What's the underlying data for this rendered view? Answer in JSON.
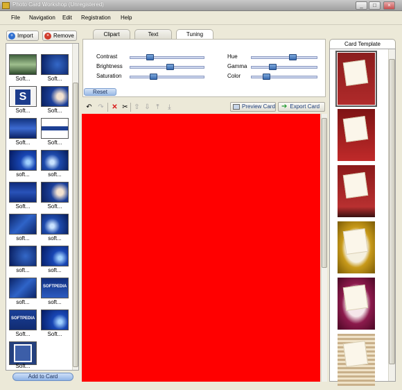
{
  "window": {
    "title": "Photo Card Workshop (Unregistered)",
    "minimize": "_",
    "maximize": "□",
    "close": "×"
  },
  "menu": [
    "File",
    "Navigation",
    "Edit",
    "Registration",
    "Help"
  ],
  "left": {
    "import_label": "Import",
    "remove_label": "Remove",
    "add_to_card_label": "Add to Card",
    "items": [
      {
        "label": "Soft...",
        "thumb": "forest"
      },
      {
        "label": "Soft...",
        "thumb": "dark-blue"
      },
      {
        "label": "Soft...",
        "thumb": "s-logo"
      },
      {
        "label": "Soft...",
        "thumb": "blue-portrait"
      },
      {
        "label": "Soft...",
        "thumb": "blue-vertical"
      },
      {
        "label": "Soft...",
        "thumb": "softpedia-banner"
      },
      {
        "label": "soft...",
        "thumb": "blue-swirl"
      },
      {
        "label": "soft...",
        "thumb": "blue-swirl-2"
      },
      {
        "label": "Soft...",
        "thumb": "blue-bar"
      },
      {
        "label": "Soft...",
        "thumb": "blue-portrait"
      },
      {
        "label": "soft...",
        "thumb": "blue-wave"
      },
      {
        "label": "soft...",
        "thumb": "blue-swirl-2"
      },
      {
        "label": "soft...",
        "thumb": "dark-blue"
      },
      {
        "label": "soft...",
        "thumb": "blue-swirl"
      },
      {
        "label": "soft...",
        "thumb": "blue-wave"
      },
      {
        "label": "soft...",
        "thumb": "softpedia-box"
      },
      {
        "label": "Soft...",
        "thumb": "softpedia-box-2"
      },
      {
        "label": "Soft...",
        "thumb": "blue-swirl"
      },
      {
        "label": "Soft...",
        "thumb": "portrait-frame"
      }
    ]
  },
  "tabs": [
    "Clipart",
    "Text",
    "Tuning"
  ],
  "tuning": {
    "sliders_left": [
      {
        "label": "Contrast",
        "value": 0.25
      },
      {
        "label": "Brightness",
        "value": 0.55
      },
      {
        "label": "Saturation",
        "value": 0.3
      }
    ],
    "sliders_right": [
      {
        "label": "Hue",
        "value": 0.65
      },
      {
        "label": "Gamma",
        "value": 0.3
      },
      {
        "label": "Color",
        "value": 0.2
      }
    ],
    "reset_label": "Reset"
  },
  "toolbar": {
    "undo_icon": "undo-icon",
    "redo_icon": "redo-icon",
    "delete_icon": "delete-icon",
    "cut_icon": "scissors-icon",
    "preview_label": "Preview Card",
    "export_label": "Export Card"
  },
  "canvas": {
    "color": "#ff0000"
  },
  "right": {
    "tab_label": "Card Template",
    "templates": [
      "red-floral",
      "red-ribbon",
      "red-tape",
      "gold-frame",
      "magenta-frame",
      "plaid-frame"
    ]
  }
}
